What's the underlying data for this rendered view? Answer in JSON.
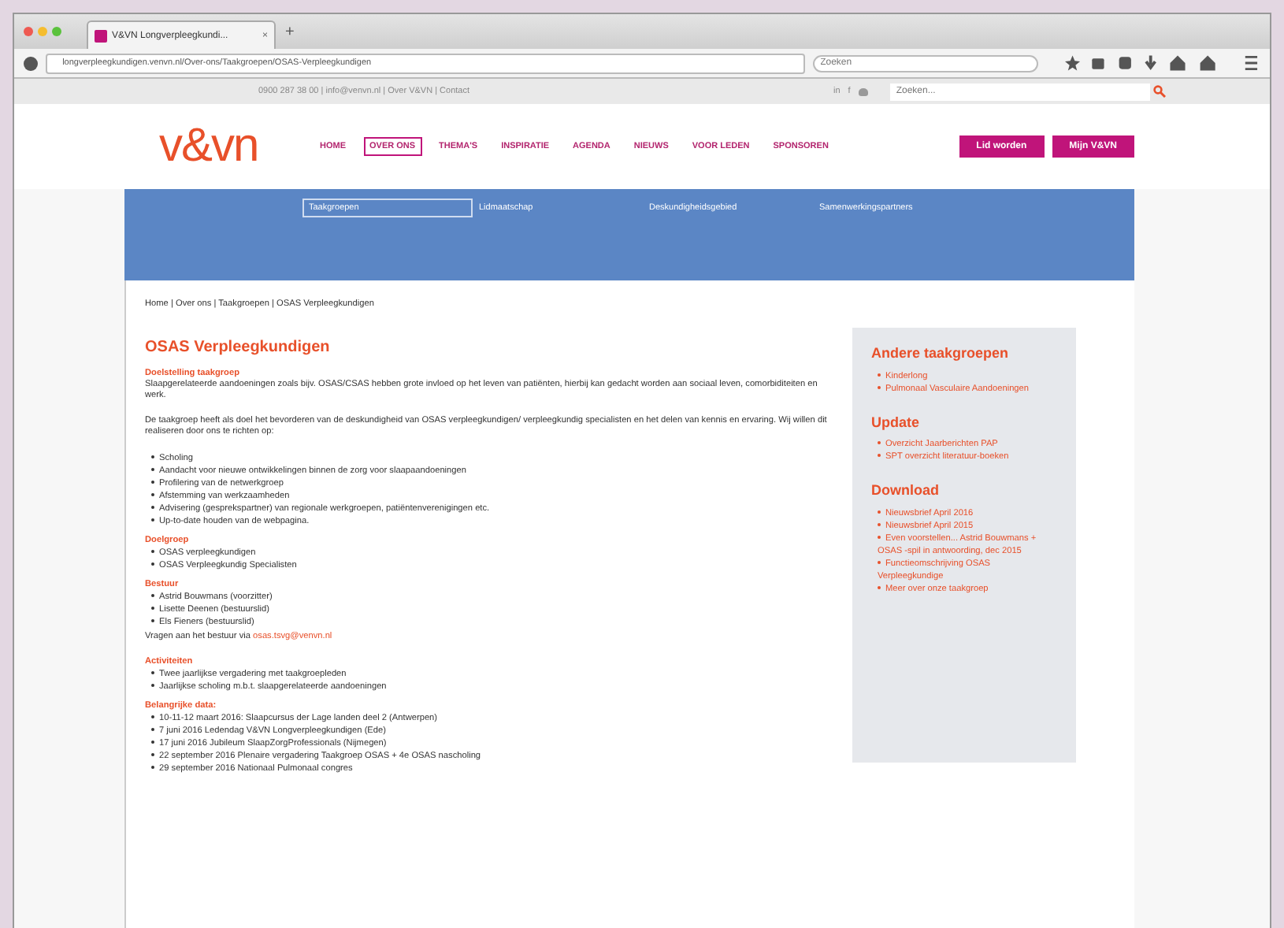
{
  "browser": {
    "tab_title": "V&VN Longverpleegkundi...",
    "tab_close": "×",
    "new_tab": "+",
    "url": "longverpleegkundigen.venvn.nl/Over-ons/Taakgroepen/OSAS-Verpleegkundigen",
    "search_placeholder": "Zoeken"
  },
  "topbar": {
    "contact": "0900 287 38 00 | info@venvn.nl | Over V&VN | Contact",
    "social": [
      "in",
      "f"
    ],
    "search_placeholder": "Zoeken..."
  },
  "logo": "v&vn",
  "nav": [
    {
      "label": "HOME",
      "selected": false
    },
    {
      "label": "OVER ONS",
      "selected": true
    },
    {
      "label": "THEMA'S",
      "selected": false
    },
    {
      "label": "INSPIRATIE",
      "selected": false
    },
    {
      "label": "AGENDA",
      "selected": false
    },
    {
      "label": "NIEUWS",
      "selected": false
    },
    {
      "label": "VOOR LEDEN",
      "selected": false
    },
    {
      "label": "SPONSOREN",
      "selected": false
    }
  ],
  "header_buttons": [
    "Lid worden",
    "Mijn V&VN"
  ],
  "subnav": [
    {
      "label": "Taakgroepen",
      "selected": true
    },
    {
      "label": "Lidmaatschap",
      "selected": false
    },
    {
      "label": "Deskundigheidsgebied",
      "selected": false
    },
    {
      "label": "Samenwerkingspartners",
      "selected": false
    }
  ],
  "breadcrumb": "Home | Over ons | Taakgroepen | OSAS Verpleegkundigen",
  "title": "OSAS Verpleegkundigen",
  "sections": [
    {
      "kind": "text",
      "heading": "Doelstelling taakgroep",
      "paragraphs": [
        "Slaapgerelateerde aandoeningen zoals bijv. OSAS/CSAS hebben grote invloed op het leven van patiënten, hierbij kan gedacht worden aan sociaal leven, comorbiditeiten en werk.",
        "De taakgroep heeft als doel het bevorderen van de deskundigheid van OSAS verpleegkundigen/ verpleegkundig specialisten en het delen van kennis en ervaring. Wij willen dit realiseren door ons te richten op:"
      ],
      "items": [
        "Scholing",
        "Aandacht voor nieuwe ontwikkelingen binnen de zorg voor slaapaandoeningen",
        "Profilering van de netwerkgroep",
        "Afstemming van werkzaamheden",
        "Advisering (gesprekspartner) van regionale werkgroepen, patiëntenverenigingen etc.",
        "Up-to-date houden van de webpagina."
      ]
    },
    {
      "kind": "list",
      "heading": "Doelgroep",
      "items": [
        "OSAS verpleegkundigen",
        "OSAS Verpleegkundig Specialisten"
      ]
    },
    {
      "kind": "list",
      "heading": "Bestuur",
      "items": [
        "Astrid Bouwmans (voorzitter)",
        "Lisette Deenen (bestuurslid)",
        "Els Fieners (bestuurslid)"
      ]
    },
    {
      "kind": "contact",
      "text": "Vragen aan het bestuur via ",
      "link": "osas.tsvg@venvn.nl"
    },
    {
      "kind": "list",
      "heading": "Activiteiten",
      "items": [
        "Twee jaarlijkse vergadering met taakgroepleden",
        "Jaarlijkse scholing m.b.t. slaapgerelateerde aandoeningen"
      ]
    },
    {
      "kind": "list",
      "heading": "Belangrijke data:",
      "items": [
        "10-11-12 maart 2016: Slaapcursus der Lage landen deel 2 (Antwerpen)",
        "7 juni 2016 Ledendag V&VN Longverpleegkundigen (Ede)",
        "17 juni 2016 Jubileum SlaapZorgProfessionals (Nijmegen)",
        "22 september 2016 Plenaire vergadering Taakgroep OSAS + 4e OSAS nascholing",
        "29 september 2016 Nationaal Pulmonaal congres"
      ]
    }
  ],
  "sidebar": [
    {
      "heading": "Andere taakgroepen",
      "links": [
        "Kinderlong",
        "Pulmonaal Vasculaire Aandoeningen"
      ]
    },
    {
      "heading": "Update",
      "links": [
        "Overzicht Jaarberichten PAP",
        "SPT overzicht literatuur-boeken"
      ]
    },
    {
      "heading": "Download",
      "links": [
        "Nieuwsbrief April 2016",
        "Nieuwsbrief April 2015",
        "Even voorstellen... Astrid Bouwmans + OSAS -spil in antwoording, dec 2015",
        "Functieomschrijving OSAS Verpleegkundige",
        "Meer over onze taakgroep"
      ]
    }
  ]
}
